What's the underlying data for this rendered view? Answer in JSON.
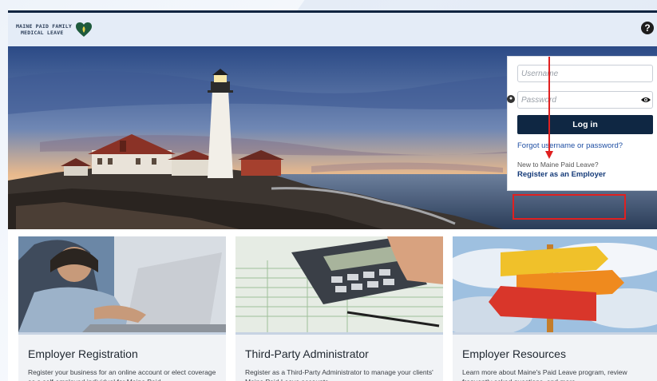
{
  "header": {
    "logo_line1": "MAINE PAID FAMILY",
    "logo_line2": "MEDICAL LEAVE",
    "help_label": "?"
  },
  "login": {
    "username_placeholder": "Username",
    "password_placeholder": "Password",
    "login_button": "Log in",
    "forgot_link": "Forgot username or password?",
    "new_prompt": "New to Maine Paid Leave?",
    "register_link": "Register as an Employer"
  },
  "cards": [
    {
      "title": "Employer Registration",
      "description": "Register your business for an online account or elect coverage as a self-employed individual for Maine Paid"
    },
    {
      "title": "Third-Party Administrator",
      "description": "Register as a Third-Party Administrator to manage your clients' Maine Paid Leave accounts"
    },
    {
      "title": "Employer Resources",
      "description": "Learn more about Maine's Paid Leave program, review frequently asked questions, and more"
    }
  ],
  "colors": {
    "navy": "#0f2743",
    "header_bg": "#e4ecf7",
    "link": "#1f4fa3",
    "highlight": "#e02020"
  }
}
